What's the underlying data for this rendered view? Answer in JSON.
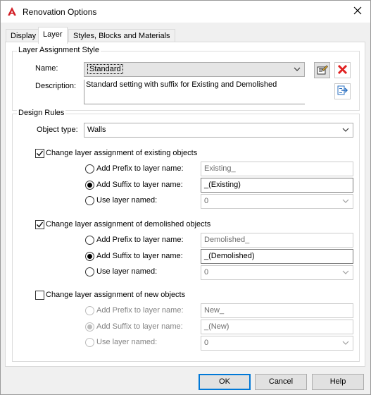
{
  "window": {
    "title": "Renovation Options"
  },
  "tabs": [
    {
      "label": "Display"
    },
    {
      "label": "Layer"
    },
    {
      "label": "Styles, Blocks and Materials"
    }
  ],
  "layer_assignment": {
    "group_label": "Layer Assignment Style",
    "name_label": "Name:",
    "name_value": "Standard",
    "description_label": "Description:",
    "description_value": "Standard setting with suffix for Existing and Demolished"
  },
  "design_rules": {
    "group_label": "Design Rules",
    "object_type_label": "Object type:",
    "object_type_value": "Walls",
    "existing": {
      "checkbox_label": "Change layer assignment of existing objects",
      "checked": true,
      "prefix_label": "Add Prefix to layer name:",
      "prefix_value": "Existing_",
      "suffix_label": "Add Suffix to layer name:",
      "suffix_value": "_(Existing)",
      "named_label": "Use layer named:",
      "named_value": "0",
      "selected": "suffix"
    },
    "demolished": {
      "checkbox_label": "Change layer assignment of demolished objects",
      "checked": true,
      "prefix_label": "Add Prefix to layer name:",
      "prefix_value": "Demolished_",
      "suffix_label": "Add Suffix to layer name:",
      "suffix_value": "_(Demolished)",
      "named_label": "Use layer named:",
      "named_value": "0",
      "selected": "suffix"
    },
    "new": {
      "checkbox_label": "Change layer assignment of new objects",
      "checked": false,
      "prefix_label": "Add Prefix to layer name:",
      "prefix_value": "New_",
      "suffix_label": "Add Suffix to layer name:",
      "suffix_value": "_(New)",
      "named_label": "Use layer named:",
      "named_value": "0",
      "selected": "suffix"
    }
  },
  "buttons": {
    "ok": "OK",
    "cancel": "Cancel",
    "help": "Help"
  },
  "icons": [
    "autocad-app-icon",
    "close-icon",
    "edit-style-icon",
    "delete-icon",
    "import-style-icon",
    "chevron-down-icon"
  ],
  "colors": {
    "accent": "#0078d7",
    "delete_red": "#e02020",
    "app_red": "#d21f26"
  }
}
